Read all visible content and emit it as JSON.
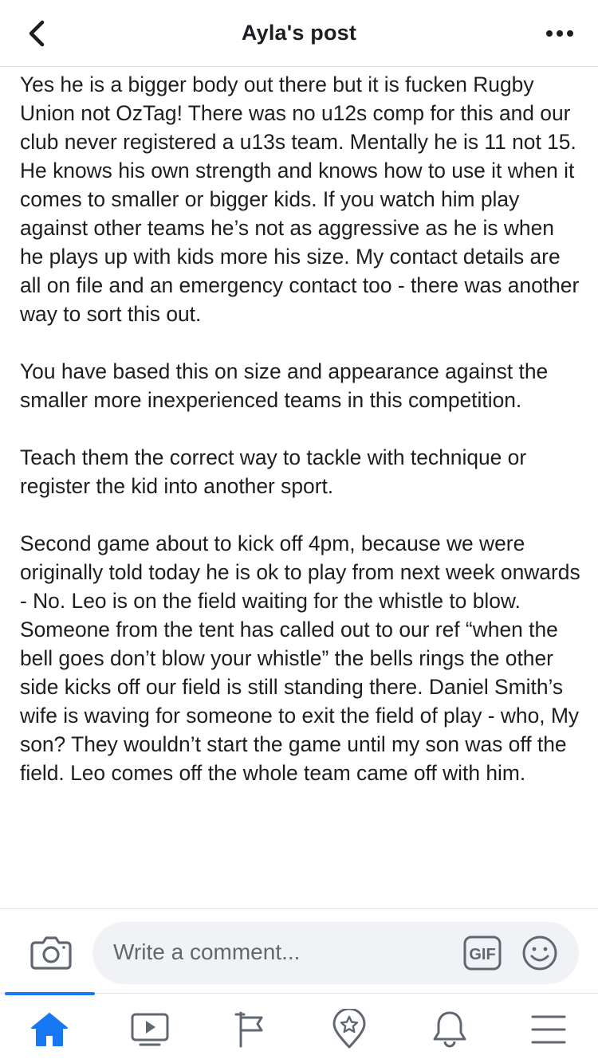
{
  "header": {
    "title": "Ayla's post",
    "back_icon": "chevron-left-icon",
    "more_icon": "more-dots-icon"
  },
  "post": {
    "paragraphs": [
      "Yes he is a bigger body out there but it is fucken Rugby Union not OzTag! There was no u12s comp for this and our club never registered a u13s team. Mentally he is 11 not 15. He knows his own strength and knows how to use it when it comes to smaller or bigger kids. If you watch him play against other teams he’s not as aggressive as he is when he plays up with kids more his size. My contact details are all on file and an emergency contact too - there was another way to sort this out.",
      "You have based this on size and appearance against the smaller more inexperienced teams in this competition.",
      "Teach them the correct way to tackle with technique or register the kid into another sport.",
      "Second game about to kick off 4pm, because we were originally told today he is ok to play from next week onwards - No. Leo is on the field waiting for the whistle to blow. Someone from the tent has called out to our ref “when the bell goes don’t blow your whistle” the bells rings the other side kicks off our field is still standing there. Daniel Smith’s wife is waving for someone to exit the field of play - who, My son? They wouldn’t start the game until my son was off the field. Leo comes off the whole team came off with him."
    ]
  },
  "comment_bar": {
    "placeholder": "Write a comment...",
    "camera_icon": "camera-icon",
    "gif_label": "GIF",
    "emoji_icon": "smiley-icon"
  },
  "tab_bar": {
    "active_tab": "home",
    "accent_color": "#1877f2",
    "inactive_color": "#65676b",
    "tabs": [
      {
        "id": "home",
        "icon": "home-icon"
      },
      {
        "id": "watch",
        "icon": "video-play-icon"
      },
      {
        "id": "pages",
        "icon": "flag-icon"
      },
      {
        "id": "explore",
        "icon": "location-star-icon"
      },
      {
        "id": "notifications",
        "icon": "bell-icon"
      },
      {
        "id": "menu",
        "icon": "hamburger-menu-icon"
      }
    ]
  }
}
